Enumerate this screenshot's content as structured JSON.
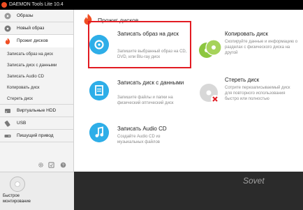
{
  "window": {
    "title": "DAEMON Tools Lite 10.4"
  },
  "sidebar": {
    "items": [
      {
        "label": "Образы",
        "icon": "disc-images-icon"
      },
      {
        "label": "Новый образ",
        "icon": "new-image-icon"
      },
      {
        "label": "Прожиг дисков",
        "icon": "burn-flame-icon"
      }
    ],
    "subitems": [
      "Записать образ на диск",
      "Записать диск с данными",
      "Записать Audio CD",
      "Копировать диск",
      "Стереть диск"
    ],
    "items_bottom": [
      {
        "label": "Виртуальные HDD",
        "icon": "hdd-icon"
      },
      {
        "label": "USB",
        "icon": "usb-icon"
      },
      {
        "label": "Пишущий привод",
        "icon": "writer-drive-icon"
      }
    ]
  },
  "quick_mount": {
    "label": "Быстрое монтирование"
  },
  "main": {
    "section_title": "Прожиг дисков",
    "cards": [
      {
        "title": "Записать образ на диск",
        "desc": "Запишите выбранный образ на CD, DVD, или Blu-ray диск"
      },
      {
        "title": "Записать диск с данными",
        "desc": "Запишите файлы и папки на физический оптический диск"
      },
      {
        "title": "Записать Audio CD",
        "desc": "Создайте Audio CD из музыкальных файлов"
      },
      {
        "title": "Копировать диск",
        "desc": "Скопируйте данные и информацию о разделах с физического диска на другой"
      },
      {
        "title": "Стереть диск",
        "desc": "Сотрите перезаписываемый диск для повторного использования быстро или полностью"
      }
    ]
  },
  "colors": {
    "accent_blue": "#2eaee8",
    "accent_green": "#8cc63f",
    "flame_orange": "#f04e23",
    "highlight_red": "#e21b22"
  },
  "watermark": {
    "text": "Sovet"
  }
}
